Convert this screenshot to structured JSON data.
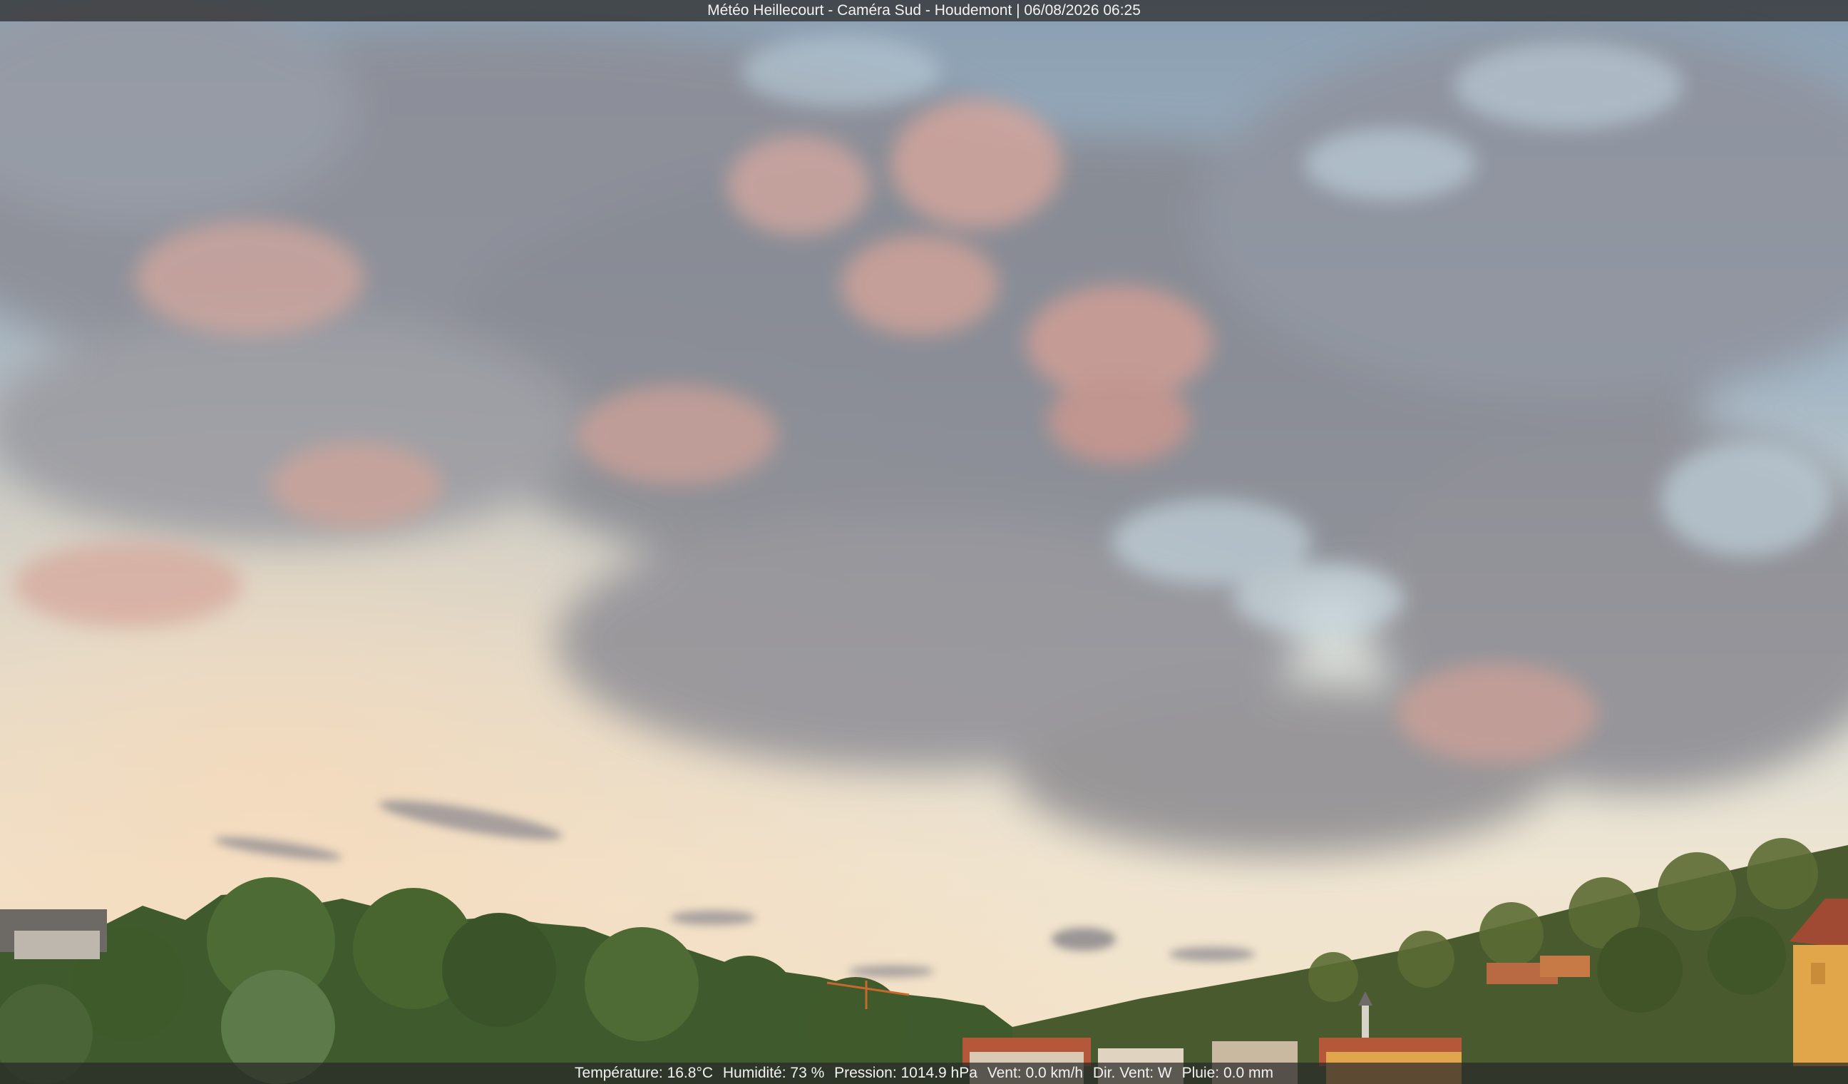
{
  "overlay": {
    "title": "Météo Heillecourt - Caméra Sud - Houdemont | 06/08/2026 06:25",
    "temperature": "Température: 16.8°C",
    "humidity": "Humidité: 73 %",
    "pressure": "Pression: 1014.9 hPa",
    "wind": "Vent: 0.0 km/h",
    "wind_dir": "Dir. Vent: W",
    "rain": "Pluie: 0.0 mm"
  },
  "colors": {
    "sky_top": "#8ea3b6",
    "sky_horizon": "#f3e6cf",
    "cloud_gray": "#8e8e96",
    "cloud_pink": "#d8a29a",
    "trees": "#3f5a2c",
    "roofs": "#b5583a",
    "wall": "#e1a54a"
  },
  "image": {
    "subject": "sky-with-altocumulus-clouds-over-trees-and-houses"
  }
}
